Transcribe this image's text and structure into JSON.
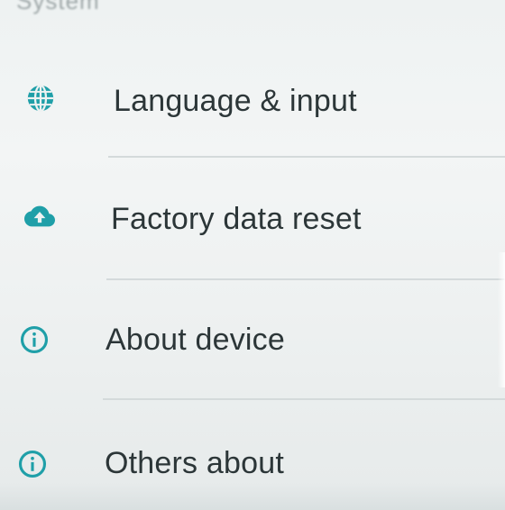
{
  "section": {
    "title": "System"
  },
  "settings": {
    "items": [
      {
        "label": "Language & input",
        "icon": "globe-icon"
      },
      {
        "label": "Factory data reset",
        "icon": "cloud-upload-icon"
      },
      {
        "label": "About device",
        "icon": "info-icon"
      },
      {
        "label": "Others about",
        "icon": "info-icon"
      }
    ]
  },
  "colors": {
    "accent": "#1f9fa8",
    "text": "#2c3638",
    "background": "#f1f4f4",
    "divider": "#d4dadb"
  }
}
